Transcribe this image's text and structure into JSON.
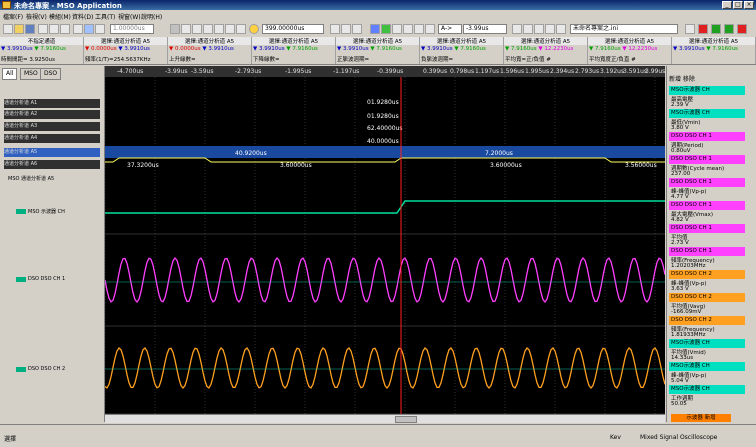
{
  "window": {
    "title": "未命名專案 - MSO Application"
  },
  "menu": [
    "檔案(F)",
    "檢視(V)",
    "模組(M)",
    "資料(D)",
    "工具(T)",
    "視窗(W)",
    "說明(H)"
  ],
  "toolbar": {
    "sample_rate": "1.00000us",
    "time_field": "399.00000us",
    "cursor_select": "A-> ",
    "cursor_value": "-3.99us",
    "project_select": "未命名專案之.ini"
  },
  "measurements": [
    {
      "header": "不指定通道",
      "value": "3.9910us",
      "value2": "7.9160us",
      "name": "時間間距= 3.9250us"
    },
    {
      "header": "選擇:通道分析道 A5",
      "value": "0.0000us",
      "value2": "3.9910us",
      "name": "頻率(1/T)=254.5637KHz"
    },
    {
      "header": "選擇:通道分析道 A5",
      "value": "0.0000us",
      "value2": "3.9910us",
      "name": "上升緣數="
    },
    {
      "header": "選擇:通道分析道 A5",
      "value": "3.9910us",
      "value2": "7.9160us",
      "name": "下降緣數="
    },
    {
      "header": "選擇:通道分析道 A5",
      "value": "3.9910us",
      "value2": "7.9160us",
      "name": "正脈波週期="
    },
    {
      "header": "選擇:通道分析道 A5",
      "value": "3.9910us",
      "value2": "7.9160us",
      "name": "負脈波週期="
    },
    {
      "header": "選擇:通道分析道 A5",
      "value": "7.9160us",
      "value2": "12.2230us",
      "name": "平均寬=正/負值 #"
    },
    {
      "header": "選擇:通道分析道 A5",
      "value": "7.9160us",
      "value2": "12.2230us",
      "name": "平均寬度正/負直 #"
    },
    {
      "header": "選擇:通道分析道 A5",
      "value": "3.9910us",
      "value2": "7.9160us",
      "name": ""
    }
  ],
  "left_panel": {
    "tabs": [
      "All",
      "MSO",
      "DSO"
    ],
    "rows": [
      "通道分析道 A1",
      "通道分析道 A2",
      "通道分析道 A3",
      "通道分析道 A4",
      "通道分析道 A5",
      "通道分析道 A6"
    ],
    "analyzer_label": "MSO 通道分析道 A5",
    "channels": [
      "MSO 示波器 CH",
      "DSO DSO CH 1",
      "DSO DSO CH 2"
    ]
  },
  "time_axis": [
    "-4.700us",
    "-3.99us",
    "-3.59us",
    "-2.793us",
    "-1.995us",
    "-1.197us",
    "-0.399us",
    "0.399us",
    "0.798us",
    "1.197us",
    "1.596us",
    "1.995us",
    "2.394us",
    "2.793us",
    "3.192us",
    "3.591us",
    "3.99us"
  ],
  "annotations": {
    "ann1": "01.9280us",
    "ann2": "01.9280us",
    "ann3": "62.40000us",
    "ann4": "40.0000us",
    "bar_left": "40.9200us",
    "bar_right": "7.2000us",
    "seg1": "37.3200us",
    "seg2": "3.60000us",
    "seg3": "3.60000us",
    "seg4": "3.56000us"
  },
  "right_panel": {
    "header": "新增  移除",
    "items": [
      {
        "h": "MSO示波器 CH",
        "sub": "最高電壓",
        "v": "2.39 V",
        "c": "#00e0c0"
      },
      {
        "h": "MSO示波器 CH",
        "sub": "最低(Vmin)",
        "v": "3.80 V",
        "c": "#00e0c0"
      },
      {
        "h": "DSO DSO CH 1",
        "sub": "週期(Period)",
        "v": "0.80uV",
        "c": "#ff40ff"
      },
      {
        "h": "DSO DSO CH 1",
        "sub": "週期數(Cycle mean)",
        "v": "237.00",
        "c": "#ff40ff"
      },
      {
        "h": "DSO DSO CH 1",
        "sub": "峰-峰值(Vp-p)",
        "v": "4.77 V",
        "c": "#ff40ff"
      },
      {
        "h": "DSO DSO CH 1",
        "sub": "最大電壓(Vmax)",
        "v": "4.82 V",
        "c": "#ff40ff"
      },
      {
        "h": "DSO DSO CH 1",
        "sub": "平均值",
        "v": "2.73 V",
        "c": "#ff40ff"
      },
      {
        "h": "DSO DSO CH 1",
        "sub": "頻率(Frequency)",
        "v": "1.20203MHz",
        "c": "#ff40ff"
      },
      {
        "h": "DSO DSO CH 2",
        "sub": "峰-峰值(Vp-p)",
        "v": "3.63 V",
        "c": "#ffa020"
      },
      {
        "h": "DSO DSO CH 2",
        "sub": "平均值(Vavg)",
        "v": "-166.09mV",
        "c": "#ffa020"
      },
      {
        "h": "DSO DSO CH 2",
        "sub": "頻率(Frequency)",
        "v": "1.81933MHz",
        "c": "#ffa020"
      },
      {
        "h": "MSO示波器 CH",
        "sub": "平均值(Vmid)",
        "v": "14.33us",
        "c": "#00e0c0"
      },
      {
        "h": "MSO示波器 CH",
        "sub": "峰-峰值(Vp-p)",
        "v": "5.04 V",
        "c": "#00e0c0"
      },
      {
        "h": "MSO示波器 CH",
        "sub": "工作週期",
        "v": "50.05",
        "c": "#00e0c0"
      }
    ],
    "bottom_button": "示波器 新增"
  },
  "status": {
    "left": "選擇",
    "mid": "Kev",
    "right": "Mixed Signal Oscilloscope"
  },
  "colors": {
    "ch_mso": "#00e0a0",
    "ch1": "#ff40ff",
    "ch2": "#ffa020",
    "cursor": "#ff2020"
  }
}
